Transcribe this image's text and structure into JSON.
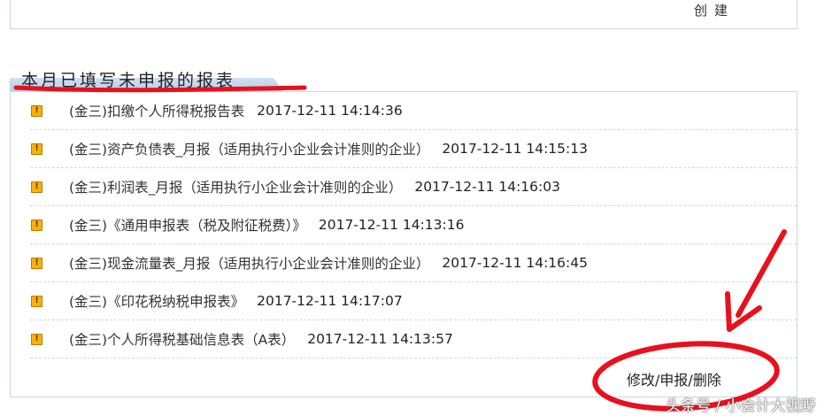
{
  "top": {
    "create_label": "创建"
  },
  "section": {
    "title": "本月已填写未申报的报表"
  },
  "reports": [
    {
      "name": "(金三)扣缴个人所得税报告表",
      "time": "2017-12-11 14:14:36"
    },
    {
      "name": "(金三)资产负债表_月报（适用执行小企业会计准则的企业）",
      "time": "2017-12-11 14:15:13"
    },
    {
      "name": "(金三)利润表_月报（适用执行小企业会计准则的企业）",
      "time": "2017-12-11 14:16:03"
    },
    {
      "name": "(金三)《通用申报表（税及附征税费）》",
      "time": "2017-12-11 14:13:16"
    },
    {
      "name": "(金三)现金流量表_月报（适用执行小企业会计准则的企业）",
      "time": "2017-12-11 14:16:45"
    },
    {
      "name": "(金三)《印花税纳税申报表》",
      "time": "2017-12-11 14:17:07"
    },
    {
      "name": "(金三)个人所得税基础信息表（A表）",
      "time": "2017-12-11 14:13:57"
    }
  ],
  "actions": {
    "modify": "修改",
    "declare": "申报",
    "delete": "删除",
    "separator": "/"
  },
  "watermark": "头条号 / 小会计大视野",
  "icons": {
    "row_icon": "warning-icon"
  },
  "colors": {
    "annotation": "#e8101e",
    "warning": "#f4b400",
    "border": "#c9d6e3"
  }
}
